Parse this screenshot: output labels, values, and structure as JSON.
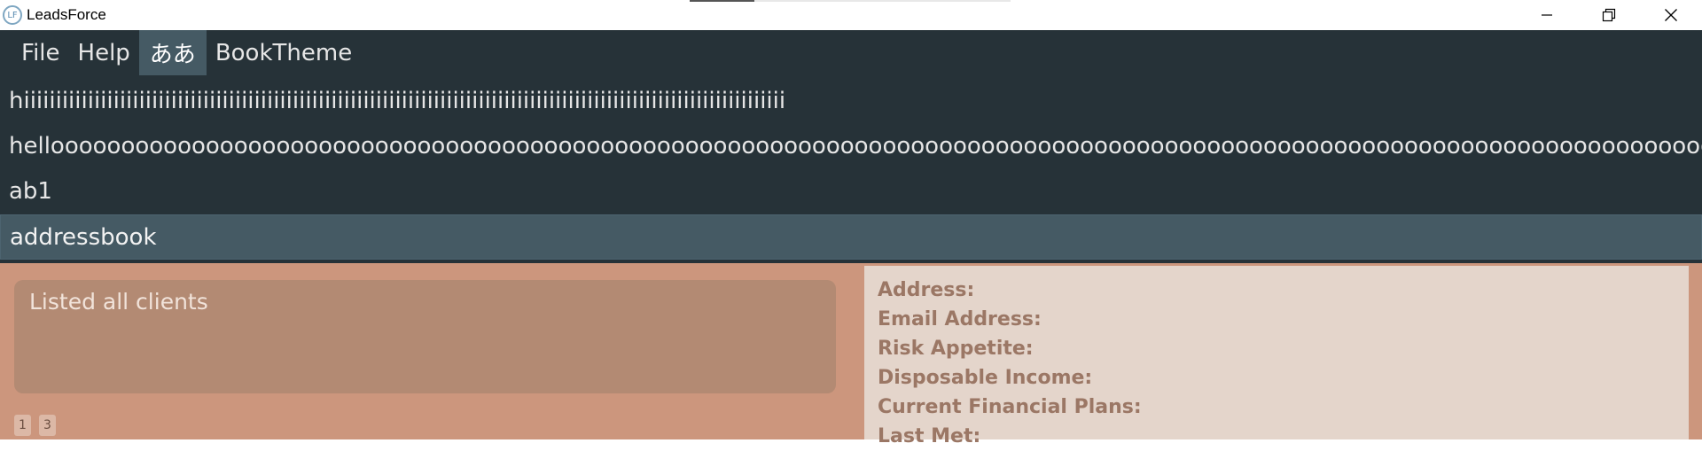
{
  "window": {
    "title": "LeadsForce",
    "icon_label": "LF",
    "controls": [
      "minimize-icon",
      "restore-icon",
      "close-icon"
    ]
  },
  "menubar": {
    "items": [
      {
        "label": "File",
        "active": false
      },
      {
        "label": "Help",
        "active": false
      },
      {
        "label": "ああ",
        "active": true
      },
      {
        "label": "BookTheme",
        "active": false
      }
    ]
  },
  "dropdown": {
    "items": [
      {
        "label": "hiiiiiiiiiiiiiiiiiiiiiiiiiiiiiiiiiiiiiiiiiiiiiiiiiiiiiiiiiiiiiiiiiiiiiiiiiiiiiiiiiiiiiiiiiiiiiiiiiiiiiiiiiiiiiiiiiiiiiii",
        "selected": false
      },
      {
        "label": "hellooooooooooooooooooooooooooooooooooooooooooooooooooooooooooooooooooooooooooooooooooooooooooooooooooooooooooooooooooooooo",
        "selected": false
      },
      {
        "label": "ab1",
        "selected": false
      },
      {
        "label": "addressbook",
        "selected": true
      }
    ]
  },
  "result": {
    "message": "Listed all clients"
  },
  "pagination": {
    "badges": [
      "1",
      "3"
    ]
  },
  "details": {
    "fields": [
      "Address:",
      "Email Address:",
      "Risk Appetite:",
      "Disposable Income:",
      "Current Financial Plans:",
      "Last Met:"
    ]
  },
  "colors": {
    "menubar_bg": "#263238",
    "selected_bg": "#455a64",
    "main_bg": "#cc967d",
    "result_box_bg": "#b38a73",
    "detail_bg": "#e4d5cb",
    "detail_text": "#9b7765"
  }
}
